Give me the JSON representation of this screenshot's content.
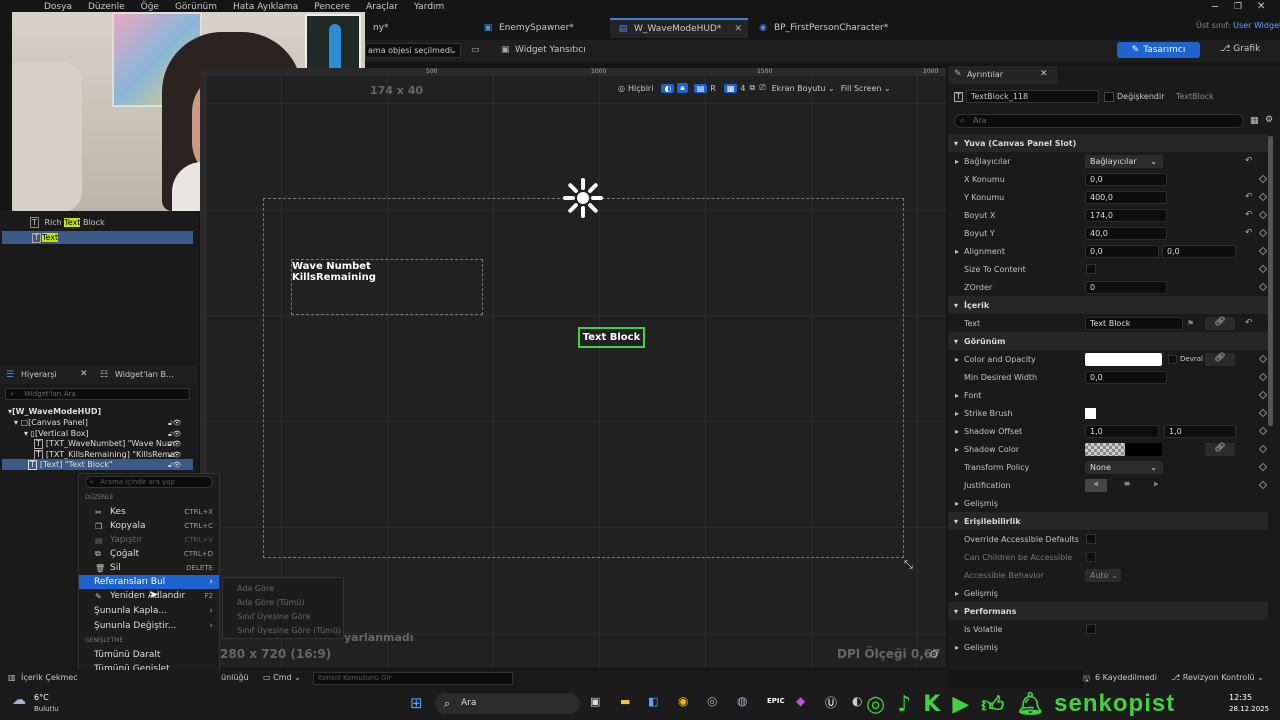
{
  "menu": [
    "Dosya",
    "Düzenle",
    "Öğe",
    "Görünüm",
    "Hata Ayıklama",
    "Pencere",
    "Araçlar",
    "Yardım"
  ],
  "title_right": {
    "parent_label": "Üst sınıf:",
    "parent_value": "User Widget"
  },
  "tabs": [
    {
      "label": "ny*"
    },
    {
      "label": "EnemySpawner*"
    },
    {
      "label": "W_WaveModeHUD*"
    },
    {
      "label": "BP_FirstPersonCharacter*"
    }
  ],
  "toolbar": {
    "selection": "ama objesi seçilmedi",
    "widget_reflector": "Widget Yansıtıcı",
    "designer": "Tasarımcı",
    "graph": "Grafik"
  },
  "viewport": {
    "size_label": "174 x 40",
    "ruler": [
      "500",
      "1000",
      "1500",
      "2000"
    ],
    "none_label": "Hiçbiri",
    "r_label": "R",
    "grid_num": "4",
    "screen_size": "Ekran Boyutu",
    "fill_screen": "Fill Screen",
    "wave_text": "Wave Numbet",
    "kills_text": "KillsRemaining",
    "text_block": "Text Block",
    "resolution": "280 x 720 (16:9)",
    "unnamed": "yarlanmadı",
    "dpi": "DPI Ölçeği 0,67"
  },
  "palette": {
    "rich": "Rich",
    "rich_hl": "Text",
    "rich_rest": "Block",
    "text": "Text"
  },
  "hierarchy": {
    "tab1": "Hiyerarşi",
    "tab2": "Widget'ları B...",
    "search_placeholder": "Widget'ları Ara",
    "items": [
      "[W_WaveModeHUD]",
      "[Canvas Panel]",
      "[Vertical Box]",
      "[TXT_WaveNumbet] \"Wave Num",
      "[TXT_KillsRemaining] \"KillsRema",
      "[Text] \"Text Block\""
    ]
  },
  "context_menu": {
    "search_placeholder": "Arama içinde ara yap",
    "section_edit": "DÜZENLE",
    "items": [
      {
        "label": "Kes",
        "key": "CTRL+X"
      },
      {
        "label": "Kopyala",
        "key": "CTRL+C"
      },
      {
        "label": "Yapıştır",
        "key": "CTRL+V"
      },
      {
        "label": "Çoğalt",
        "key": "CTRL+D"
      },
      {
        "label": "Sil",
        "key": "DELETE"
      },
      {
        "label": "Referansları Bul",
        "key": ""
      },
      {
        "label": "Yeniden Adlandır",
        "key": "F2"
      },
      {
        "label": "Şununla Kapla...",
        "key": ""
      },
      {
        "label": "Şununla Değiştir...",
        "key": ""
      }
    ],
    "section_expand": "GENİŞLETME",
    "collapse_all": "Tümünü Daralt",
    "expand_all": "Tümünü Genişlet"
  },
  "submenu": [
    "Ada Göre",
    "Ada Göre (Tümü)",
    "Sınıf Üyesine Göre",
    "Sınıf Üyesine Göre (Tümü)"
  ],
  "details": {
    "tab": "Ayrıntılar",
    "name": "TextBlock_118",
    "is_variable": "Değişkendir",
    "class": "TextBlock",
    "search_placeholder": "Ara",
    "slot_section": "Yuva (Canvas Panel Slot)",
    "anchors_label": "Bağlayıcılar",
    "anchors_value": "Bağlayıcılar",
    "x_label": "X Konumu",
    "x_value": "0,0",
    "y_label": "Y Konumu",
    "y_value": "400,0",
    "sx_label": "Boyut X",
    "sx_value": "174,0",
    "sy_label": "Boyut Y",
    "sy_value": "40,0",
    "align_label": "Alignment",
    "align_x": "0,0",
    "align_y": "0,0",
    "stc_label": "Size To Content",
    "z_label": "ZOrder",
    "z_value": "0",
    "content_section": "İçerik",
    "text_label": "Text",
    "text_value": "Text Block",
    "appearance_section": "Görünüm",
    "color_label": "Color and Opacity",
    "inherit": "Devral",
    "mdw_label": "Min Desired Width",
    "mdw_value": "0,0",
    "font_label": "Font",
    "strike_label": "Strike Brush",
    "so_label": "Shadow Offset",
    "so_x": "1,0",
    "so_y": "1,0",
    "sc_label": "Shadow Color",
    "tp_label": "Transform Policy",
    "tp_value": "None",
    "just_label": "Justification",
    "advanced1": "Gelişmiş",
    "access_section": "Erişilebilirlik",
    "oad_label": "Override Accessible Defaults",
    "ccba_label": "Can Children be Accessible",
    "ab_label": "Accessible Behavior",
    "ab_value": "Auto",
    "advanced2": "Gelişmiş",
    "perf_section": "Performans",
    "volatile_label": "Is Volatile",
    "advanced3": "Gelişmiş"
  },
  "statusbar": {
    "content": "İçerik Çekmec",
    "output": "ünlüğü",
    "cmd": "Cmd",
    "console_placeholder": "Konsol Komutunu Gir",
    "saved": "6 Kaydedilmedi",
    "revision": "Revizyon Kontrolü"
  },
  "taskbar": {
    "temp": "6°C",
    "weather": "Bulutlu",
    "search": "Ara",
    "brand": "senkopist",
    "time": "12:35",
    "date": "28.12.2025"
  },
  "colors": {
    "accent": "#1f63d1",
    "select": "#3c5a88",
    "highlight": "#c6e600",
    "green": "#41d141"
  }
}
